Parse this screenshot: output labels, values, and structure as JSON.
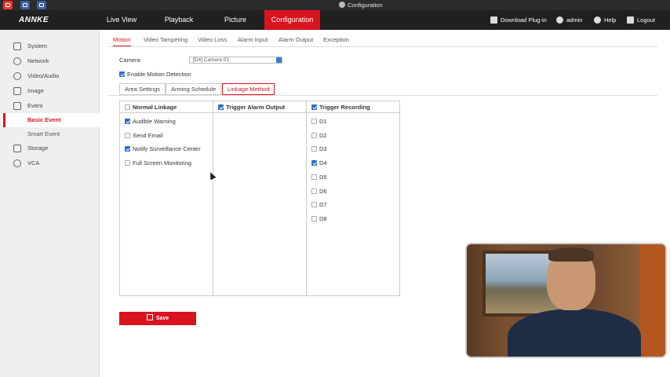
{
  "window": {
    "title": "Configuration"
  },
  "brand": {
    "logo": "ANNKE",
    "accent": "#d9141e"
  },
  "topnav": {
    "items": [
      "Live View",
      "Playback",
      "Picture",
      "Configuration"
    ],
    "active": "Configuration",
    "right": {
      "plugin": "Download Plug-in",
      "user": "admin",
      "help": "Help",
      "logout": "Logout"
    }
  },
  "sidebar": {
    "items": {
      "system": "System",
      "network": "Network",
      "video_audio": "Video/Audio",
      "image": "Image",
      "event": "Event",
      "basic_event": "Basic Event",
      "smart_event": "Smart Event",
      "storage": "Storage",
      "vca": "VCA"
    },
    "active": "Basic Event"
  },
  "tabs": [
    "Motion",
    "Video Tampering",
    "Video Loss",
    "Alarm Input",
    "Alarm Output",
    "Exception"
  ],
  "form": {
    "camera_label": "Camera",
    "camera_value": "[D4] Camera 01",
    "enable_motion_label": "Enable Motion Detection",
    "enable_motion_checked": true
  },
  "steps": [
    "Area Settings",
    "Arming Schedule",
    "Linkage Method"
  ],
  "active_step": "Linkage Method",
  "linkage": {
    "normal": {
      "title": "Normal Linkage",
      "checked": false,
      "items": [
        {
          "label": "Audible Warning",
          "checked": true
        },
        {
          "label": "Send Email",
          "checked": false
        },
        {
          "label": "Notify Surveillance Center",
          "checked": true
        },
        {
          "label": "Full Screen Monitoring",
          "checked": false
        }
      ]
    },
    "alarm_output": {
      "title": "Trigger Alarm Output",
      "checked": true
    },
    "recording": {
      "title": "Trigger Recording",
      "checked": true,
      "items": [
        {
          "label": "D1",
          "checked": false
        },
        {
          "label": "D2",
          "checked": false
        },
        {
          "label": "D3",
          "checked": false
        },
        {
          "label": "D4",
          "checked": true
        },
        {
          "label": "D5",
          "checked": false
        },
        {
          "label": "D6",
          "checked": false
        },
        {
          "label": "D7",
          "checked": false
        },
        {
          "label": "D8",
          "checked": false
        }
      ]
    }
  },
  "save_label": "Save"
}
